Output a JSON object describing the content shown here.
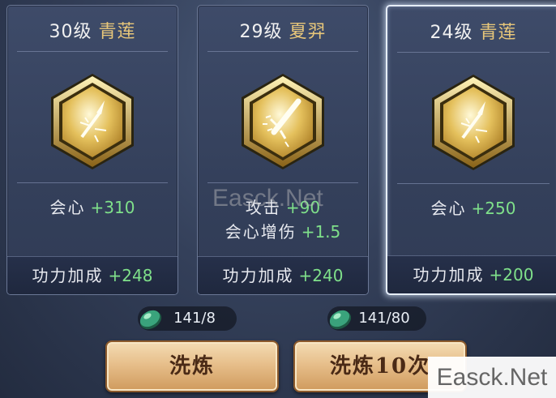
{
  "cards": [
    {
      "level": "30级",
      "name": "青莲",
      "icon": "arrow-emblem-icon",
      "stats": [
        {
          "label": "会心",
          "value": "+310"
        }
      ],
      "bonus": {
        "label": "功力加成",
        "value": "+248"
      }
    },
    {
      "level": "29级",
      "name": "夏羿",
      "icon": "sword-emblem-icon",
      "stats": [
        {
          "label": "攻击",
          "value": "+90"
        },
        {
          "label": "会心增伤",
          "value": "+1.5"
        }
      ],
      "bonus": {
        "label": "功力加成",
        "value": "+240"
      }
    },
    {
      "level": "24级",
      "name": "青莲",
      "icon": "arrow-emblem-icon",
      "selected": true,
      "stats": [
        {
          "label": "会心",
          "value": "+250"
        }
      ],
      "bonus": {
        "label": "功力加成",
        "value": "+200"
      }
    }
  ],
  "costs": [
    {
      "icon": "jade-token-icon",
      "text": "141/8"
    },
    {
      "icon": "jade-token-icon",
      "text": "141/80"
    }
  ],
  "buttons": {
    "refine": "洗炼",
    "refine10": "洗炼10次"
  },
  "watermark": {
    "center": "Easck.Net",
    "corner": "Easck.Net"
  },
  "colors": {
    "stat_value": "#7fe08a",
    "name": "#e8c77a",
    "button_text": "#4a2a16"
  }
}
